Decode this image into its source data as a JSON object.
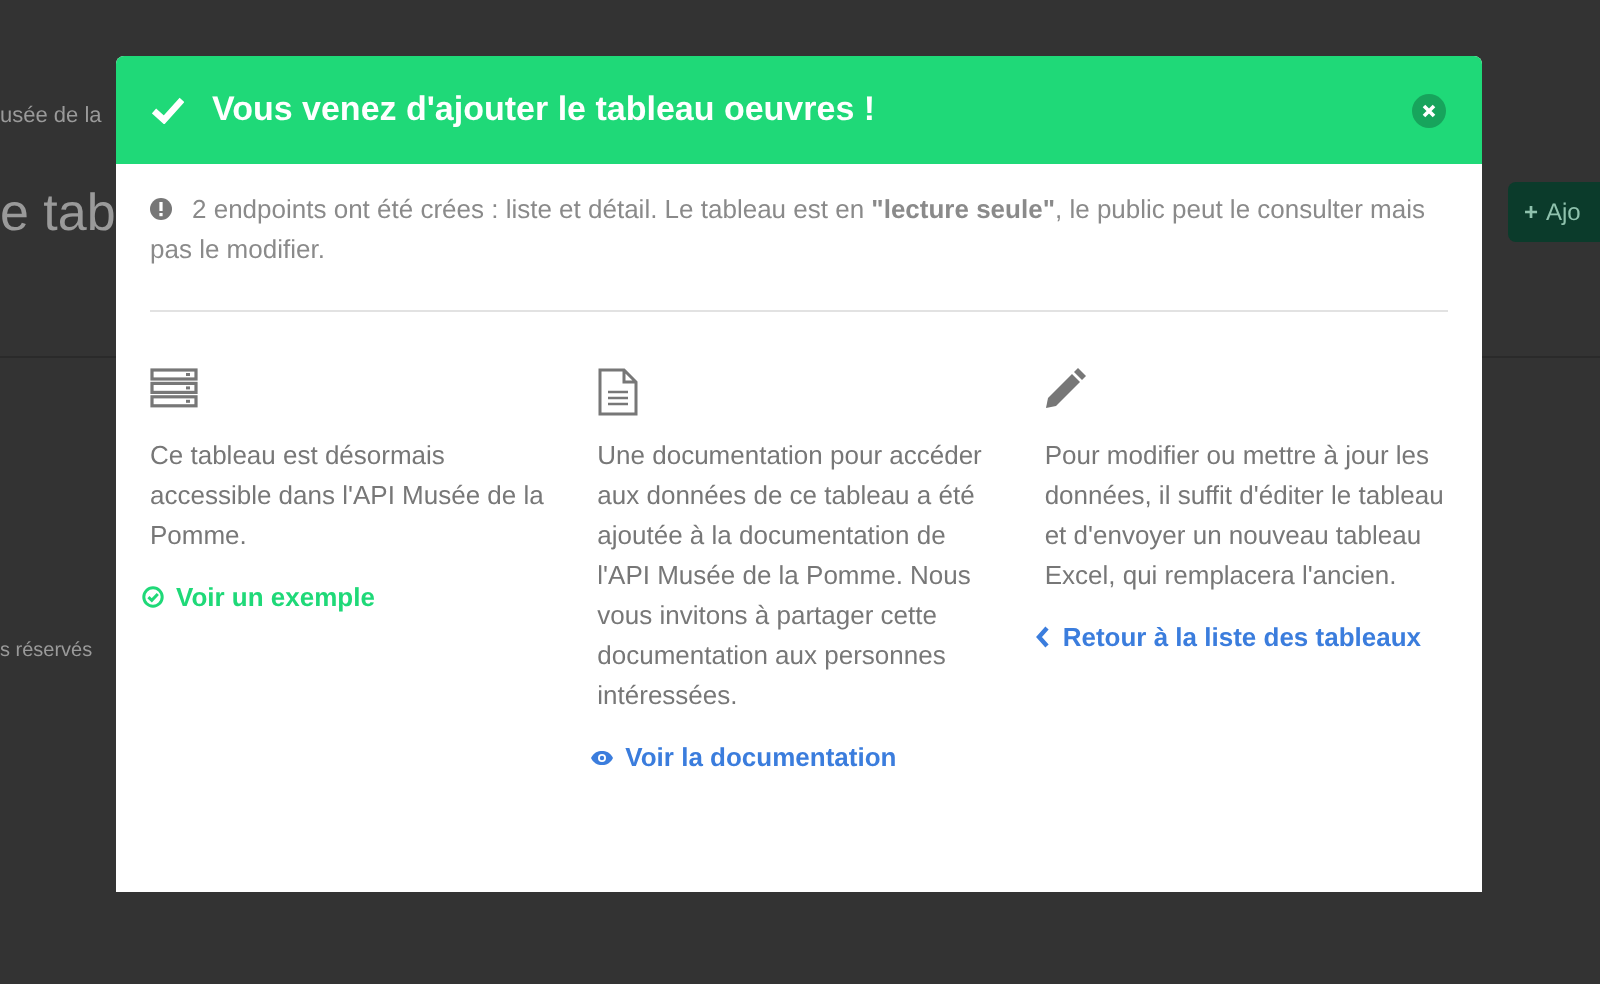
{
  "background_page": {
    "breadcrumb": "usée de la",
    "heading": "e tab",
    "add_button": {
      "icon": "+",
      "label": "Ajo"
    },
    "footer": "s réservés"
  },
  "modal": {
    "title": "Vous venez d'ajouter le tableau oeuvres !",
    "notice": "2 endpoints ont été crées : liste et détail. Le tableau est en **\"lecture seule\"**, le public peut le consulter mais pas le modifier.",
    "columns": [
      {
        "kind": "server",
        "text": "Ce tableau est désormais accessible dans l'API Musée de la Pomme.",
        "link": {
          "kind": "check",
          "label": "Voir un exemple"
        }
      },
      {
        "kind": "document",
        "text": "Une documentation pour accéder aux données de ce tableau a été ajoutée à la documentation de l'API Musée de la Pomme. Nous vous invitons à partager cette documentation aux personnes intéressées.",
        "link": {
          "kind": "eye",
          "label": "Voir la documentation"
        }
      },
      {
        "kind": "pencil",
        "text": "Pour modifier ou mettre à jour les données, il suffit d'éditer le tableau et d'envoyer un nouveau tableau Excel, qui remplacera l'ancien.",
        "link": {
          "kind": "back",
          "label": "Retour à la liste des tableaux"
        }
      }
    ]
  }
}
